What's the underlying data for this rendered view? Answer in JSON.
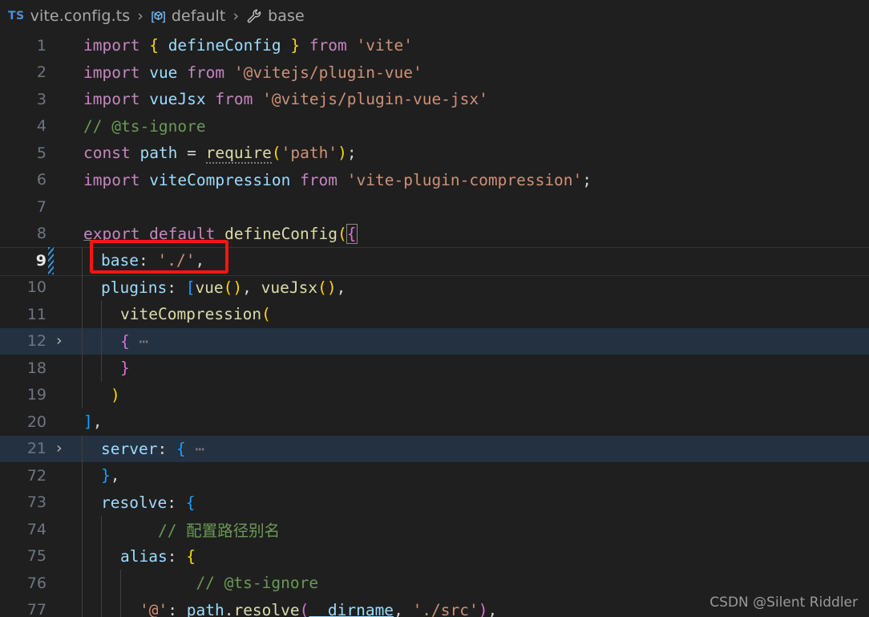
{
  "breadcrumb": {
    "file_icon": "typescript-file-icon",
    "file_icon_label": "TS",
    "separator": "›",
    "items": [
      {
        "label": "vite.config.ts",
        "icon": "typescript-file-icon"
      },
      {
        "label": "default",
        "icon": "symbol-variable-icon"
      },
      {
        "label": "base",
        "icon": "symbol-property-wrench-icon"
      }
    ]
  },
  "editor": {
    "language": "typescript",
    "active_line": 9,
    "folded_lines": [
      12,
      21
    ],
    "modified_lines": [
      9
    ],
    "lines": [
      {
        "num": "1",
        "text": "import { defineConfig } from 'vite'"
      },
      {
        "num": "2",
        "text": "import vue from '@vitejs/plugin-vue'"
      },
      {
        "num": "3",
        "text": "import vueJsx from '@vitejs/plugin-vue-jsx'"
      },
      {
        "num": "4",
        "text": "// @ts-ignore"
      },
      {
        "num": "5",
        "text": "const path = require('path');"
      },
      {
        "num": "6",
        "text": "import viteCompression from 'vite-plugin-compression';"
      },
      {
        "num": "7",
        "text": ""
      },
      {
        "num": "8",
        "text": "export default defineConfig({"
      },
      {
        "num": "9",
        "text": "  base: './',"
      },
      {
        "num": "10",
        "text": "  plugins: [vue(), vueJsx(),"
      },
      {
        "num": "11",
        "text": "    viteCompression("
      },
      {
        "num": "12",
        "text": "    { ⋯"
      },
      {
        "num": "18",
        "text": "    }"
      },
      {
        "num": "19",
        "text": "  )"
      },
      {
        "num": "20",
        "text": "],",
        "note": "closing bracket of plugins array"
      },
      {
        "num": "21",
        "text": "  server: { ⋯"
      },
      {
        "num": "72",
        "text": "  },"
      },
      {
        "num": "73",
        "text": "  resolve: {"
      },
      {
        "num": "74",
        "text": "    // 配置路径别名"
      },
      {
        "num": "75",
        "text": "    alias: {"
      },
      {
        "num": "76",
        "text": "      // @ts-ignore"
      },
      {
        "num": "77",
        "text": "      '@': path.resolve(__dirname, './src'),"
      }
    ]
  },
  "annotation": {
    "type": "red-rectangle",
    "color": "#fd1414",
    "targets_line": 9,
    "targets_text": "base: './',"
  },
  "watermark": {
    "text": "CSDN @Silent Riddler"
  },
  "colors": {
    "background": "#1f1f1f",
    "folded_line_bg": "#243141",
    "keyword": "#c586c0",
    "variable": "#9cdcfe",
    "function": "#dcdcaa",
    "string": "#ce9178",
    "comment": "#6a9955",
    "operator": "#d4d4d4",
    "bracket1": "#ffd700",
    "bracket2": "#da70d6",
    "bracket3": "#179fff",
    "line_number": "#6e7681",
    "active_line_number": "#e6e6e6",
    "diff_modified": "#3794d8",
    "annotation_red": "#fd1414"
  }
}
